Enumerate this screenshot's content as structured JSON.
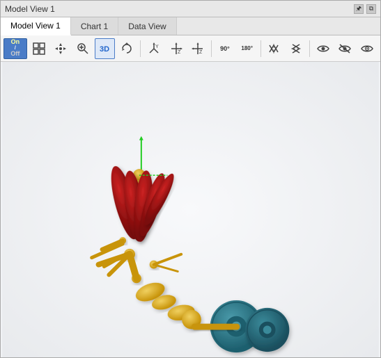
{
  "window": {
    "title": "Model View 1",
    "title_controls": {
      "pin_label": "🖈",
      "float_label": "⧉"
    }
  },
  "tabs": [
    {
      "id": "model-view",
      "label": "Model View 1",
      "active": true
    },
    {
      "id": "chart",
      "label": "Chart 1",
      "active": false
    },
    {
      "id": "data-view",
      "label": "Data View",
      "active": false
    }
  ],
  "toolbar": {
    "buttons": [
      {
        "id": "on-off",
        "label": "On\nOff",
        "type": "on-off"
      },
      {
        "id": "grid",
        "label": "grid",
        "type": "icon"
      },
      {
        "id": "move",
        "label": "move",
        "type": "icon"
      },
      {
        "id": "zoom-box",
        "label": "zoom-box",
        "type": "icon"
      },
      {
        "id": "rotate-3d",
        "label": "3D",
        "type": "3d-text",
        "active": true
      },
      {
        "id": "rotate-mode",
        "label": "rotate-mode",
        "type": "icon"
      },
      {
        "id": "y-axis",
        "label": "Y",
        "type": "axis"
      },
      {
        "id": "z-axis-1",
        "label": "Z",
        "type": "axis"
      },
      {
        "id": "z-axis-2",
        "label": "Z",
        "type": "axis"
      },
      {
        "id": "rot-90",
        "label": "90°",
        "type": "angle"
      },
      {
        "id": "rot-180",
        "label": "180°",
        "type": "angle"
      },
      {
        "id": "flip-h",
        "label": "flip-h",
        "type": "icon"
      },
      {
        "id": "flip-v",
        "label": "flip-v",
        "type": "icon"
      },
      {
        "id": "eye-1",
        "label": "eye",
        "type": "icon"
      },
      {
        "id": "eye-2",
        "label": "eye-slash",
        "type": "icon"
      },
      {
        "id": "eye-3",
        "label": "eye-3d",
        "type": "icon"
      }
    ]
  },
  "viewport": {
    "background_color": "#f0f2f5"
  },
  "model": {
    "description": "3D robotic arm model with red muscle-like segments, yellow skeleton, and teal wheel"
  }
}
